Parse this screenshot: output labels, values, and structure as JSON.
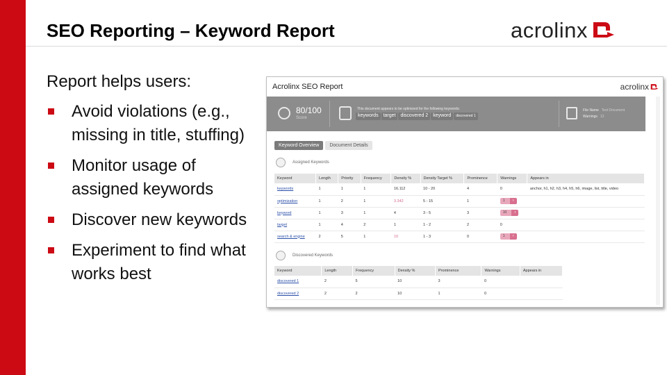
{
  "slide": {
    "title": "SEO Reporting – Keyword Report",
    "logo_text": "acrolinx",
    "lead": "Report helps users:",
    "bullets": [
      "Avoid violations (e.g., missing in title, stuffing)",
      "Monitor usage of assigned keywords",
      "Discover new keywords",
      "Experiment to find what works best"
    ],
    "colors": {
      "accent": "#cc0a14",
      "band": "#8c8c8c"
    }
  },
  "report": {
    "title": "Acrolinx SEO Report",
    "logo_text": "acrolinx",
    "score": {
      "value": "80/100",
      "label": "Score"
    },
    "optimized_text": "This document appears to be optimized for the following keywords:",
    "optimized_chips": [
      "keywords",
      "target",
      "discovered 2",
      "keyword",
      "discovered 1"
    ],
    "file": {
      "name_label": "File Name",
      "name_value": "Test Document",
      "warnings_label": "Warnings",
      "warnings_value": "12"
    },
    "tabs": [
      {
        "label": "Keyword Overview",
        "active": true
      },
      {
        "label": "Document Details",
        "active": false
      }
    ],
    "assigned": {
      "heading": "Assigned Keywords",
      "columns": [
        "Keyword",
        "Length",
        "Priority",
        "Frequency",
        "Density %",
        "Density Target %",
        "Prominence",
        "Warnings",
        "Appears in"
      ],
      "rows": [
        {
          "keyword": "keywords",
          "length": "1",
          "priority": "1",
          "frequency": "1",
          "density": "16.112",
          "density_hl": false,
          "target": "10 - 20",
          "prominence": "4",
          "warnings": "0",
          "warn_btn": false,
          "appears": "anchor, h1, h2, h3, h4, h5, h6, image, list, title, video"
        },
        {
          "keyword": "optimization",
          "length": "1",
          "priority": "2",
          "frequency": "1",
          "density": "3.342",
          "density_hl": true,
          "target": "5 - 15",
          "prominence": "1",
          "warnings": "1",
          "warn_btn": true,
          "appears": ""
        },
        {
          "keyword": "keyword",
          "length": "1",
          "priority": "3",
          "frequency": "1",
          "density": "4",
          "density_hl": false,
          "target": "3 - 5",
          "prominence": "3",
          "warnings": "10",
          "warn_btn": true,
          "appears": ""
        },
        {
          "keyword": "target",
          "length": "1",
          "priority": "4",
          "frequency": "2",
          "density": "1",
          "density_hl": false,
          "target": "1 - 2",
          "prominence": "2",
          "warnings": "0",
          "warn_btn": false,
          "appears": ""
        },
        {
          "keyword": "search & engine",
          "length": "2",
          "priority": "5",
          "frequency": "1",
          "density": "10",
          "density_hl": true,
          "target": "1 - 3",
          "prominence": "0",
          "warnings": "1",
          "warn_btn": true,
          "appears": ""
        }
      ]
    },
    "discovered": {
      "heading": "Discovered Keywords",
      "columns": [
        "Keyword",
        "Length",
        "Frequency",
        "Density %",
        "Prominence",
        "Warnings",
        "Appears in"
      ],
      "rows": [
        {
          "keyword": "discovered 1",
          "length": "2",
          "frequency": "5",
          "density": "10",
          "prominence": "3",
          "warnings": "0",
          "appears": ""
        },
        {
          "keyword": "discovered 2",
          "length": "2",
          "frequency": "2",
          "density": "10",
          "prominence": "1",
          "warnings": "0",
          "appears": ""
        }
      ]
    },
    "icons": [
      "score-icon",
      "keyword-icon",
      "file-icon",
      "assigned-keywords-icon",
      "discovered-keywords-icon",
      "arrow-right-icon"
    ]
  }
}
